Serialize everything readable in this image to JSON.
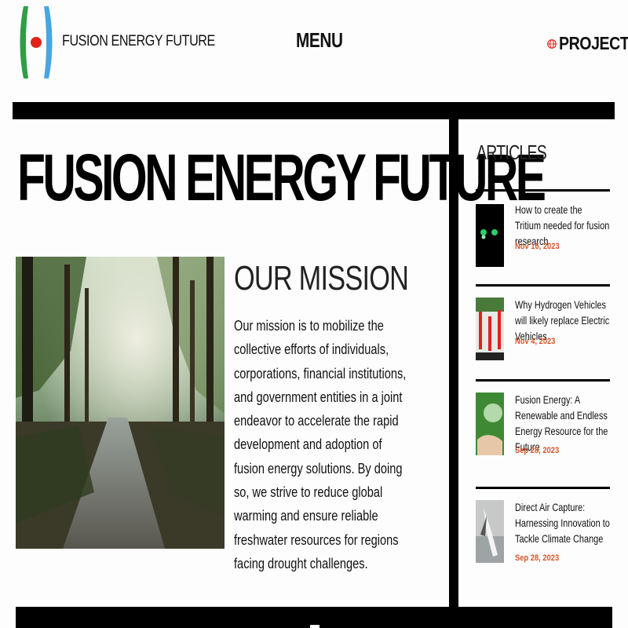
{
  "header": {
    "brand": "FUSION ENERGY FUTURE",
    "menu_label": "MENU",
    "projects_label": "PROJECTS",
    "logo_colors": {
      "left": "#2e9e45",
      "dot": "#e2231a",
      "right": "#4aa6e0"
    }
  },
  "hero": {
    "title": "FUSION ENERGY FUTURE"
  },
  "mission": {
    "title": "OUR MISSION",
    "text": "Our mission is to mobilize the collective efforts of individuals, corporations, financial institutions, and government entities in a joint endeavor to accelerate the rapid development and adoption of fusion energy solutions. By doing so, we strive to reduce global warming and ensure reliable freshwater resources for regions facing drought challenges."
  },
  "sidebar": {
    "title": "ARTICLES",
    "accent": "#d8552a",
    "articles": [
      {
        "title": "How to create the Tritium needed for fusion research",
        "date": "Nov 16, 2023"
      },
      {
        "title": "Why Hydrogen Vehicles will likely replace Electric Vehicles.",
        "date": "Nov 4, 2023"
      },
      {
        "title": "Fusion Energy: A Renewable and Endless Energy Resource for the Future",
        "date": "Sep 28, 2023"
      },
      {
        "title": "Direct Air Capture: Harnessing Innovation to Tackle Climate Change",
        "date": "Sep 28, 2023"
      }
    ]
  }
}
